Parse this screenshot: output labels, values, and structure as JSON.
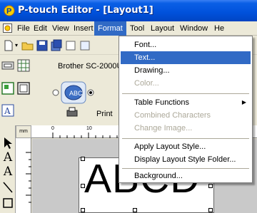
{
  "window": {
    "title": "P-touch Editor - [Layout1]"
  },
  "menubar": {
    "items": [
      {
        "label": "File"
      },
      {
        "label": "Edit"
      },
      {
        "label": "View"
      },
      {
        "label": "Insert"
      },
      {
        "label": "Format"
      },
      {
        "label": "Tool"
      },
      {
        "label": "Layout"
      },
      {
        "label": "Window"
      },
      {
        "label": "He"
      }
    ],
    "active": "Format"
  },
  "printer": {
    "name": "Brother SC-2000U",
    "print_label": "Print"
  },
  "canvas": {
    "ruler_unit": "mm",
    "ruler_ticks": [
      "0",
      "10"
    ],
    "label_text": "ABCD"
  },
  "format_menu": {
    "items": [
      {
        "label": "Font...",
        "enabled": true
      },
      {
        "label": "Text...",
        "enabled": true,
        "highlighted": true
      },
      {
        "label": "Drawing...",
        "enabled": true
      },
      {
        "label": "Color...",
        "enabled": false
      },
      {
        "label": "Table Functions",
        "enabled": true,
        "submenu": true
      },
      {
        "label": "Combined Characters",
        "enabled": false
      },
      {
        "label": "Change Image...",
        "enabled": false
      },
      {
        "label": "Apply Layout Style...",
        "enabled": true
      },
      {
        "label": "Display Layout Style Folder...",
        "enabled": true
      },
      {
        "label": "Background...",
        "enabled": true
      }
    ]
  },
  "colors": {
    "titlebar": "#0054e3",
    "menu_highlight": "#316ac5",
    "disabled_text": "#aca899"
  }
}
